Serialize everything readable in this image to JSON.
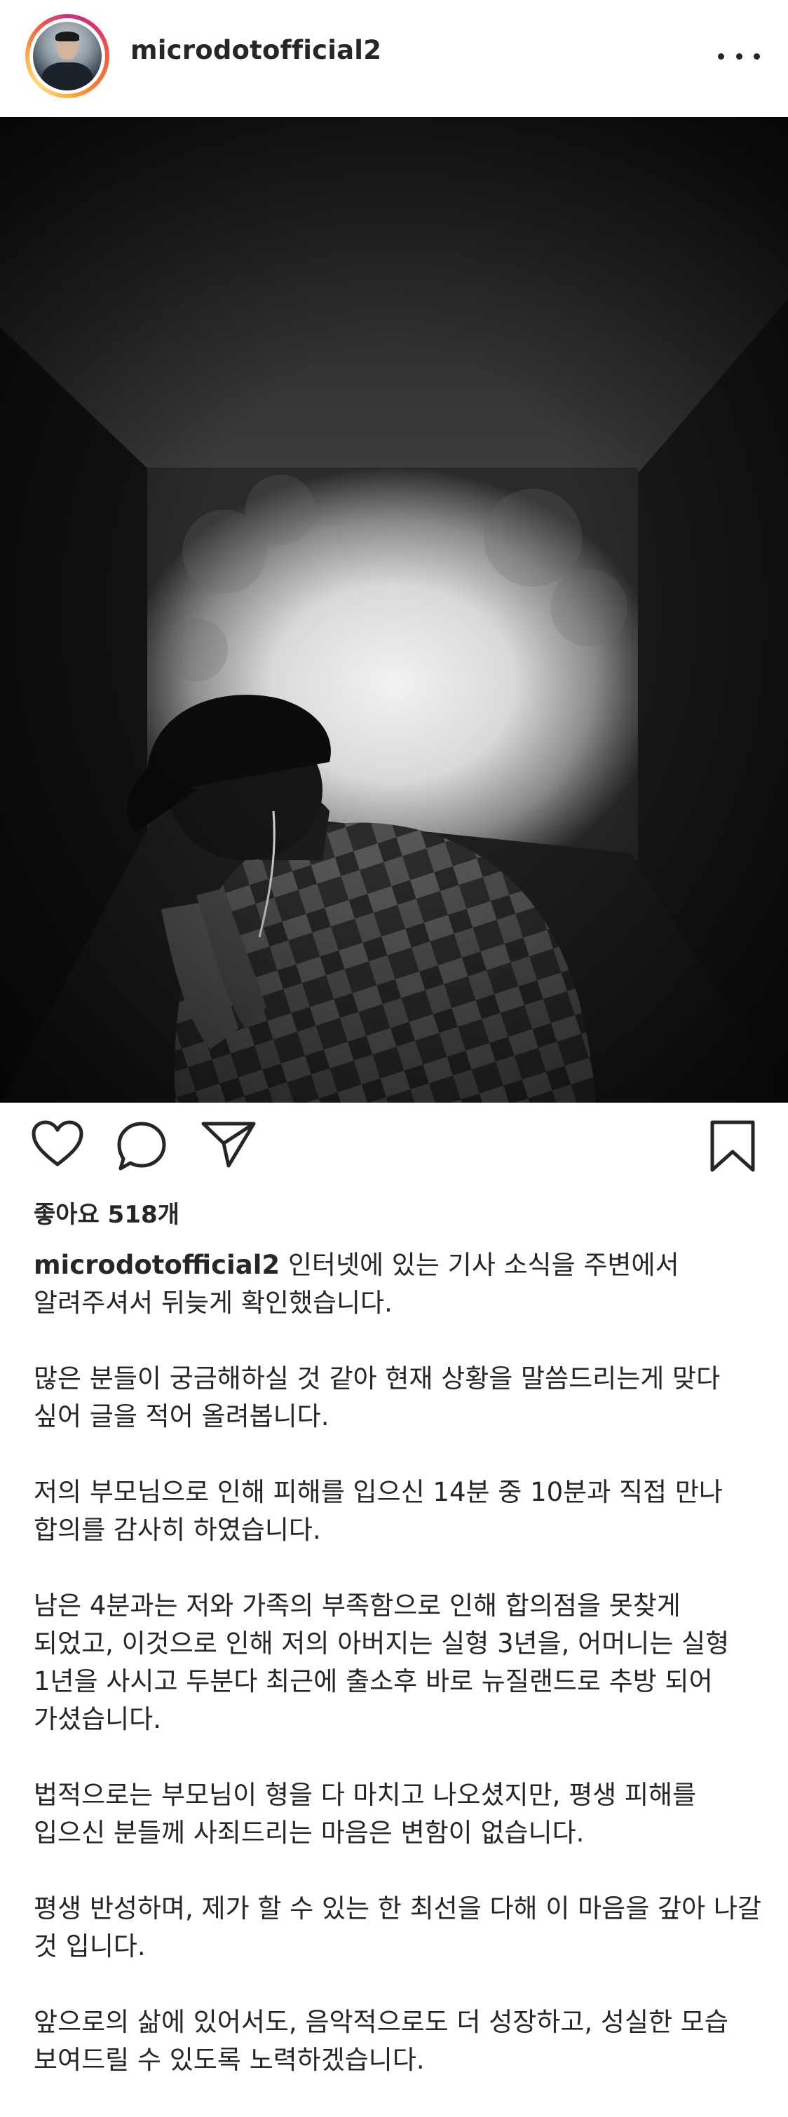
{
  "post": {
    "username": "microdotofficial2",
    "likes_text": "좋아요 518개",
    "caption": [
      "인터넷에 있는 기사 소식을 주변에서 알려주셔서 뒤늦게 확인했습니다.",
      "많은 분들이 궁금해하실 것 같아 현재 상황을 말씀드리는게 맞다 싶어 글을 적어 올려봅니다.",
      "저의 부모님으로 인해 피해를 입으신 14분 중 10분과 직접 만나 합의를 감사히 하였습니다.",
      "남은 4분과는 저와 가족의 부족함으로 인해 합의점을 못찾게 되었고, 이것으로 인해 저의 아버지는 실형 3년을, 어머니는 실형 1년을 사시고 두분다 최근에 출소후 바로 뉴질랜드로 추방 되어 가셨습니다.",
      "법적으로는 부모님이 형을 다 마치고 나오셨지만, 평생 피해를 입으신 분들께 사죄드리는 마음은 변함이 없습니다.",
      "평생 반성하며, 제가 할 수 있는 한 최선을 다해 이 마음을 갚아 나갈 것 입니다.",
      "앞으로의 삶에 있어서도, 음악적으로도 더 성장하고, 성실한 모습 보여드릴 수 있도록 노력하겠습니다."
    ]
  },
  "icons": {
    "more": "more-options-icon",
    "like": "heart-icon",
    "comment": "comment-icon",
    "share": "paper-plane-icon",
    "save": "bookmark-icon"
  },
  "colors": {
    "text": "#262626",
    "story_ring": [
      "#c13584",
      "#e1306c",
      "#f56040",
      "#fcaf45"
    ],
    "background": "#ffffff"
  }
}
